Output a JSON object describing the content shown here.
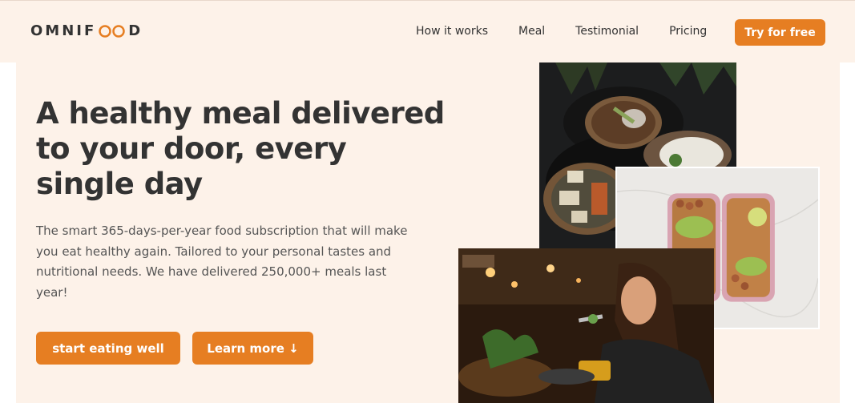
{
  "header": {
    "logo_text_left": "OMNIF",
    "logo_text_right": "D",
    "nav": [
      {
        "label": "How it works"
      },
      {
        "label": "Meal"
      },
      {
        "label": "Testimonial"
      },
      {
        "label": "Pricing"
      }
    ],
    "cta_label": "Try for free"
  },
  "hero": {
    "title": "A healthy meal delivered to your door, every single day",
    "description": "The smart 365-days-per-year food subscription that will make you eat healthy again. Tailored to your personal tastes and nutritional needs. We have delivered 250,000+ meals last year!",
    "primary_button": "start eating well",
    "secondary_button": "Learn more ↓"
  },
  "colors": {
    "accent": "#e67e22",
    "background": "#fdf2e9",
    "text": "#333333"
  },
  "icons": [
    "omnifood-infinity-logo-icon"
  ]
}
